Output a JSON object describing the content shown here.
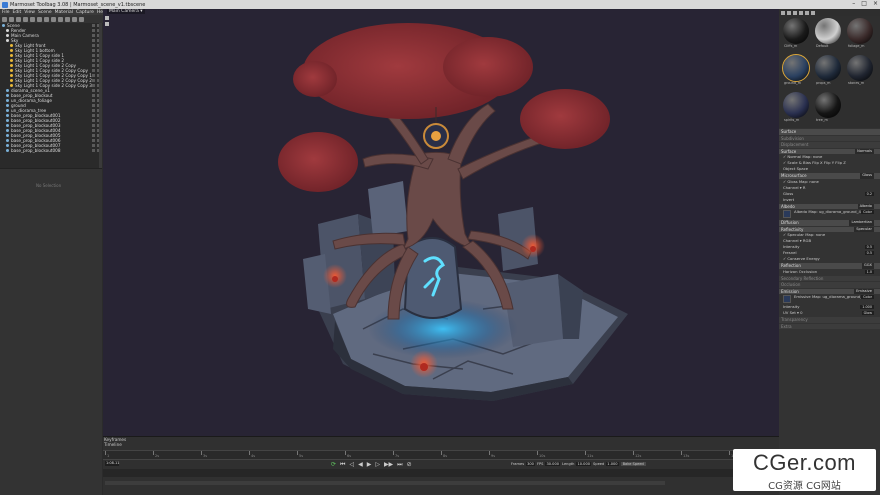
{
  "window": {
    "title": "Marmoset Toolbag 3.08  |  Marmoset_scene_v1.tbscene",
    "controls": [
      "–",
      "□",
      "×"
    ]
  },
  "menu": [
    "File",
    "Edit",
    "View",
    "Scene",
    "Material",
    "Capture",
    "Help"
  ],
  "viewport": {
    "camera_label": "Main Camera ▾"
  },
  "scene_tree": [
    {
      "label": "Scene",
      "color": "#7ab0d8",
      "indent": 0
    },
    {
      "label": "Render",
      "color": "#d8d8d8",
      "indent": 1
    },
    {
      "label": "Main Camera",
      "color": "#d8d8d8",
      "indent": 1
    },
    {
      "label": "Sky",
      "color": "#d8d8d8",
      "indent": 1
    },
    {
      "label": "Sky Light front",
      "color": "#e8b83a",
      "indent": 2
    },
    {
      "label": "Sky Light 1 bottom",
      "color": "#e8b83a",
      "indent": 2
    },
    {
      "label": "Sky Light 1 Copy side 1",
      "color": "#e8b83a",
      "indent": 2
    },
    {
      "label": "Sky Light 1 Copy side 2",
      "color": "#e8b83a",
      "indent": 2
    },
    {
      "label": "Sky Light 1 Copy side 2 Copy",
      "color": "#e8b83a",
      "indent": 2
    },
    {
      "label": "Sky Light 1 Copy side 2 Copy Copy",
      "color": "#e8b83a",
      "indent": 2
    },
    {
      "label": "Sky Light 1 Copy side 2 Copy Copy 1",
      "color": "#e8b83a",
      "indent": 2
    },
    {
      "label": "Sky Light 1 Copy side 2 Copy Copy 2",
      "color": "#e8b83a",
      "indent": 2
    },
    {
      "label": "Sky Light 1 Copy side 2 Copy Copy 3",
      "color": "#e8b83a",
      "indent": 2
    },
    {
      "label": "diorama_scene_v1",
      "color": "#7ab0d8",
      "indent": 1
    },
    {
      "label": "base_prop_blockout",
      "color": "#7ab0d8",
      "indent": 1
    },
    {
      "label": "un_diorama_foliage",
      "color": "#7ab0d8",
      "indent": 1
    },
    {
      "label": "ground",
      "color": "#7ab0d8",
      "indent": 1
    },
    {
      "label": "un_diorama_tree",
      "color": "#7ab0d8",
      "indent": 1
    },
    {
      "label": "base_prop_blockout001",
      "color": "#7ab0d8",
      "indent": 1
    },
    {
      "label": "base_prop_blockout002",
      "color": "#7ab0d8",
      "indent": 1
    },
    {
      "label": "base_prop_blockout003",
      "color": "#7ab0d8",
      "indent": 1
    },
    {
      "label": "base_prop_blockout004",
      "color": "#7ab0d8",
      "indent": 1
    },
    {
      "label": "base_prop_blockout005",
      "color": "#7ab0d8",
      "indent": 1
    },
    {
      "label": "base_prop_blockout006",
      "color": "#7ab0d8",
      "indent": 1
    },
    {
      "label": "base_prop_blockout007",
      "color": "#7ab0d8",
      "indent": 1
    },
    {
      "label": "base_prop_blockout008",
      "color": "#7ab0d8",
      "indent": 1
    }
  ],
  "properties_panel": {
    "empty_text": "No Selection"
  },
  "materials": [
    {
      "label": "Cliffs_m",
      "ball": "#1a1a1a",
      "selected": false
    },
    {
      "label": "Default",
      "ball": "#d0d0d0",
      "selected": false
    },
    {
      "label": "foliage_m",
      "ball": "#3a2a2a",
      "selected": false
    },
    {
      "label": "ground_m",
      "ball": "#2a4060",
      "selected": true
    },
    {
      "label": "props_m",
      "ball": "#1f2a3a",
      "selected": false
    },
    {
      "label": "stones_m",
      "ball": "#202530",
      "selected": false
    },
    {
      "label": "spirits_m",
      "ball": "#2a3050",
      "selected": false
    },
    {
      "label": "tree_m",
      "ball": "#151515",
      "selected": false
    }
  ],
  "material_editor": [
    {
      "kind": "sec",
      "label": "Surface",
      "value": ""
    },
    {
      "kind": "dim",
      "label": "Subdivision",
      "value": ""
    },
    {
      "kind": "dim",
      "label": "Displacement",
      "value": ""
    },
    {
      "kind": "sec",
      "label": "Surface",
      "value": "Normals"
    },
    {
      "kind": "row",
      "label": "✓ Normal Map: none",
      "value": ""
    },
    {
      "kind": "row",
      "label": "✓ Scale & Bias    Flip X    Flip Y    Flip Z",
      "value": ""
    },
    {
      "kind": "row",
      "label": "  Object Space",
      "value": ""
    },
    {
      "kind": "sec",
      "label": "Microsurface",
      "value": "Gloss"
    },
    {
      "kind": "row",
      "label": "✓ Gloss Map: none",
      "value": ""
    },
    {
      "kind": "row",
      "label": "          Channel ▾  R",
      "value": ""
    },
    {
      "kind": "row",
      "label": "          Gloss",
      "value": "0.2"
    },
    {
      "kind": "row",
      "label": "  Invert",
      "value": ""
    },
    {
      "kind": "sec",
      "label": "Albedo",
      "value": "Albedo"
    },
    {
      "kind": "map",
      "label": "Albedo Map: ug_diorama_ground_4",
      "value": "Color"
    },
    {
      "kind": "sec",
      "label": "Diffusion",
      "value": "Lambertian"
    },
    {
      "kind": "sec",
      "label": "Reflectivity",
      "value": "Specular"
    },
    {
      "kind": "row",
      "label": "✓ Specular Map: none",
      "value": ""
    },
    {
      "kind": "row",
      "label": "          Channel ▾  RGB",
      "value": ""
    },
    {
      "kind": "row",
      "label": "     Intensity",
      "value": "0.5"
    },
    {
      "kind": "row",
      "label": "     Fresnel",
      "value": "0.5"
    },
    {
      "kind": "row",
      "label": "✓ Conserve Energy",
      "value": ""
    },
    {
      "kind": "sec",
      "label": "Reflection",
      "value": "GGX"
    },
    {
      "kind": "row",
      "label": "     Horizon Occlusion",
      "value": "1.0"
    },
    {
      "kind": "dim",
      "label": "Secondary Reflection",
      "value": ""
    },
    {
      "kind": "dim",
      "label": "Occlusion",
      "value": ""
    },
    {
      "kind": "sec",
      "label": "Emission",
      "value": "Emissive"
    },
    {
      "kind": "map",
      "label": "Emissive Map: ug_diorama_ground_4",
      "value": "Color"
    },
    {
      "kind": "row",
      "label": "     Intensity",
      "value": "1.000"
    },
    {
      "kind": "row",
      "label": "UV Set ▾  0",
      "value": "Glow"
    },
    {
      "kind": "dim",
      "label": "Transparency",
      "value": ""
    },
    {
      "kind": "dim",
      "label": "Extra",
      "value": ""
    }
  ],
  "timeline": {
    "keyframes_label": "Keyframes",
    "timeline_label": "Timeline",
    "current_frame": "1:08.11",
    "tick_labels": [
      "1",
      "2s",
      "3s",
      "4s",
      "5s",
      "6s",
      "7s",
      "8s",
      "9s",
      "10s",
      "11s",
      "12s",
      "13s",
      "14s"
    ],
    "frames_label": "Frames",
    "frames_value": "300",
    "fps_label": "FPS",
    "fps_value": "30.000",
    "length_label": "Length",
    "length_value": "10.000",
    "speed_label": "Speed",
    "speed_value": "1.000",
    "bake_label": "Bake Speed"
  },
  "watermark": {
    "line1": "CGer.com",
    "line2": "CG资源 CG网站"
  },
  "colors": {
    "viewport_bg": "#282434",
    "foliage": "#8a2d33",
    "trunk": "#6a4a48",
    "stone": "#5d6578",
    "glow": "#3cc8ff",
    "accent": "#d9a53a"
  }
}
